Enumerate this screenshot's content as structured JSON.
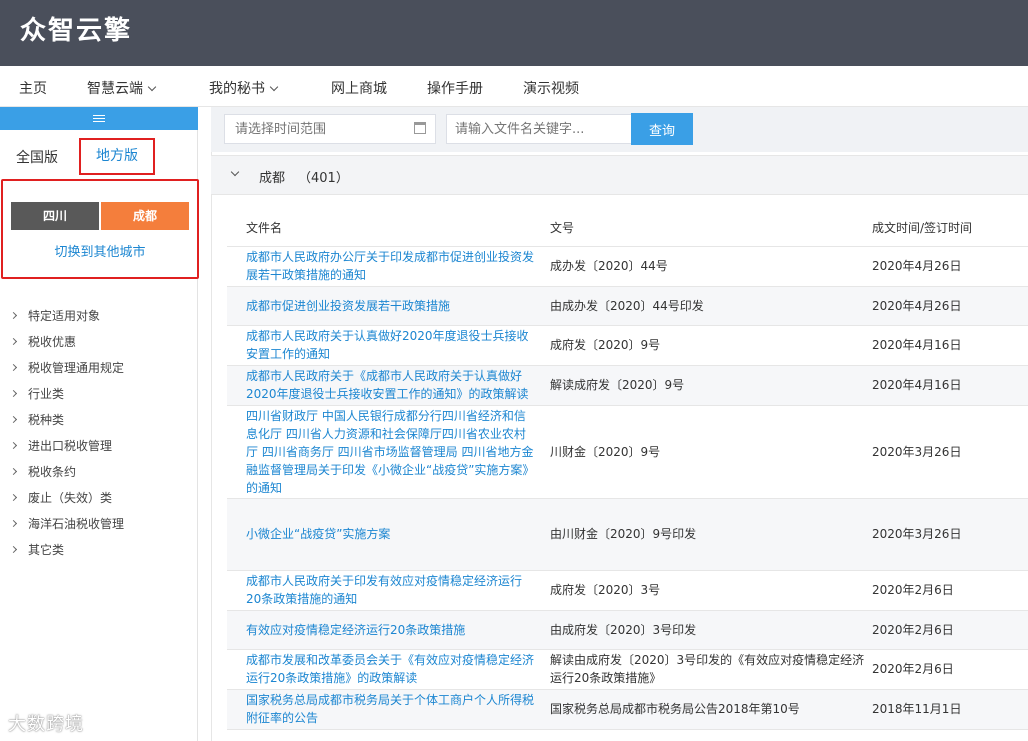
{
  "app": {
    "logo": "众智云擎"
  },
  "nav": [
    {
      "label": "主页"
    },
    {
      "label": "智慧云端"
    },
    {
      "label": "我的秘书"
    },
    {
      "label": "网上商城"
    },
    {
      "label": "操作手册"
    },
    {
      "label": "演示视频"
    }
  ],
  "sidebar": {
    "tabs": {
      "national": "全国版",
      "local": "地方版"
    },
    "province": "四川",
    "city": "成都",
    "switch_label": "切换到其他城市",
    "categories": [
      "特定适用对象",
      "税收优惠",
      "税收管理通用规定",
      "行业类",
      "税种类",
      "进出口税收管理",
      "税收条约",
      "废止（失效）类",
      "海洋石油税收管理",
      "其它类"
    ]
  },
  "search": {
    "date_placeholder": "请选择时间范围",
    "keyword_placeholder": "请输入文件名关键字...",
    "button": "查询"
  },
  "group": {
    "title": "成都",
    "count": "（401）"
  },
  "table": {
    "headers": [
      "文件名",
      "文号",
      "成文时间/签订时间"
    ],
    "rows": [
      {
        "name": "成都市人民政府办公厅关于印发成都市促进创业投资发展若干政策措施的通知",
        "no": "成办发〔2020〕44号",
        "date": "2020年4月26日"
      },
      {
        "name": "成都市促进创业投资发展若干政策措施",
        "no": "由成办发〔2020〕44号印发",
        "date": "2020年4月26日"
      },
      {
        "name": "成都市人民政府关于认真做好2020年度退役士兵接收安置工作的通知",
        "no": "成府发〔2020〕9号",
        "date": "2020年4月16日"
      },
      {
        "name": "成都市人民政府关于《成都市人民政府关于认真做好2020年度退役士兵接收安置工作的通知》的政策解读",
        "no": "解读成府发〔2020〕9号",
        "date": "2020年4月16日"
      },
      {
        "name": "四川省财政厅 中国人民银行成都分行四川省经济和信息化厅 四川省人力资源和社会保障厅四川省农业农村厅 四川省商务厅 四川省市场监督管理局 四川省地方金融监督管理局关于印发《小微企业“战疫贷”实施方案》的通知",
        "no": "川财金〔2020〕9号",
        "date": "2020年3月26日"
      },
      {
        "name": "小微企业“战疫贷”实施方案",
        "no": "由川财金〔2020〕9号印发",
        "date": "2020年3月26日"
      },
      {
        "name": "成都市人民政府关于印发有效应对疫情稳定经济运行20条政策措施的通知",
        "no": "成府发〔2020〕3号",
        "date": "2020年2月6日"
      },
      {
        "name": "有效应对疫情稳定经济运行20条政策措施",
        "no": "由成府发〔2020〕3号印发",
        "date": "2020年2月6日"
      },
      {
        "name": "成都市发展和改革委员会关于《有效应对疫情稳定经济运行20条政策措施》的政策解读",
        "no": "解读由成府发〔2020〕3号印发的《有效应对疫情稳定经济运行20条政策措施》",
        "date": "2020年2月6日"
      },
      {
        "name": "国家税务总局成都市税务局关于个体工商户个人所得税附征率的公告",
        "no": "国家税务总局成都市税务局公告2018年第10号",
        "date": "2018年11月1日"
      }
    ]
  },
  "watermark": "大数跨境"
}
